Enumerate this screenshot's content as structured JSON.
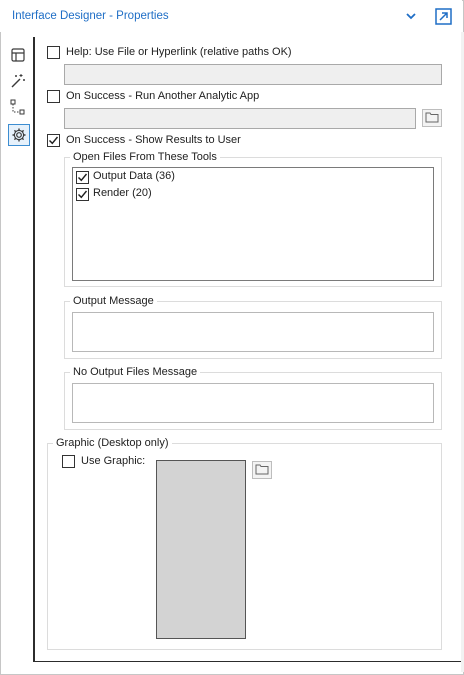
{
  "window": {
    "title": "Interface Designer - Properties"
  },
  "sidebar": {
    "items": [
      {
        "icon": "layout-icon"
      },
      {
        "icon": "magic-wand-icon"
      },
      {
        "icon": "tree-icon"
      },
      {
        "icon": "gear-icon",
        "active": true
      }
    ]
  },
  "help": {
    "label": "Help: Use File or Hyperlink (relative paths OK)",
    "checked": false,
    "value": ""
  },
  "run_app": {
    "label": "On Success - Run Another Analytic App",
    "checked": false,
    "value": ""
  },
  "show_results": {
    "label": "On Success - Show Results to User",
    "checked": true,
    "open_files": {
      "legend": "Open Files From These Tools",
      "items": [
        {
          "label": "Output Data (36)",
          "checked": true
        },
        {
          "label": "Render (20)",
          "checked": true
        }
      ]
    },
    "output_message": {
      "legend": "Output Message",
      "value": ""
    },
    "no_output_message": {
      "legend": "No Output Files Message",
      "value": ""
    }
  },
  "graphic": {
    "legend": "Graphic (Desktop only)",
    "use_label": "Use Graphic:",
    "checked": false
  },
  "colors": {
    "accent": "#1f6ec6",
    "active_border": "#3c8dd1",
    "graphic_fill": "#d3d3d3"
  }
}
